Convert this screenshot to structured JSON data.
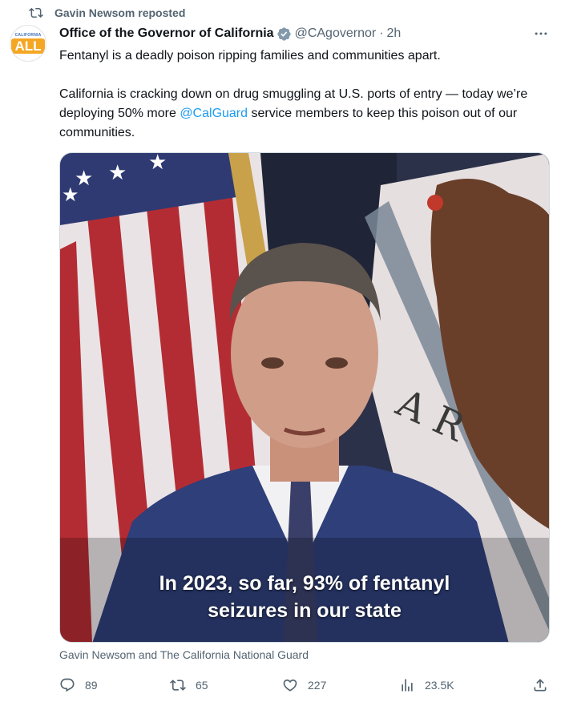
{
  "repost": {
    "label": "Gavin Newsom reposted",
    "icon": "repost-icon"
  },
  "author": {
    "avatar_top": "CALIFORNIA",
    "avatar_main": "ALL",
    "name": "Office of the Governor of California",
    "verified_icon": "verified-badge-icon",
    "handle": "@CAgovernor",
    "separator": "·",
    "time": "2h"
  },
  "tweet": {
    "line1": "Fentanyl is a deadly poison ripping families and communities apart.",
    "para2_before": "California is cracking down on drug smuggling at U.S. ports of entry — today we’re deploying 50% more ",
    "mention": "@CalGuard",
    "para2_after": " service members to keep this poison out of our communities."
  },
  "media": {
    "caption_line1": "In 2023, so far, 93% of fentanyl",
    "caption_line2": "seizures in our state",
    "credit": "Gavin Newsom and The California National Guard"
  },
  "actions": {
    "reply_count": "89",
    "repost_count": "65",
    "like_count": "227",
    "views_count": "23.5K"
  },
  "colors": {
    "link": "#1d9bf0",
    "secondary_text": "#536471",
    "primary_text": "#0f1419"
  }
}
